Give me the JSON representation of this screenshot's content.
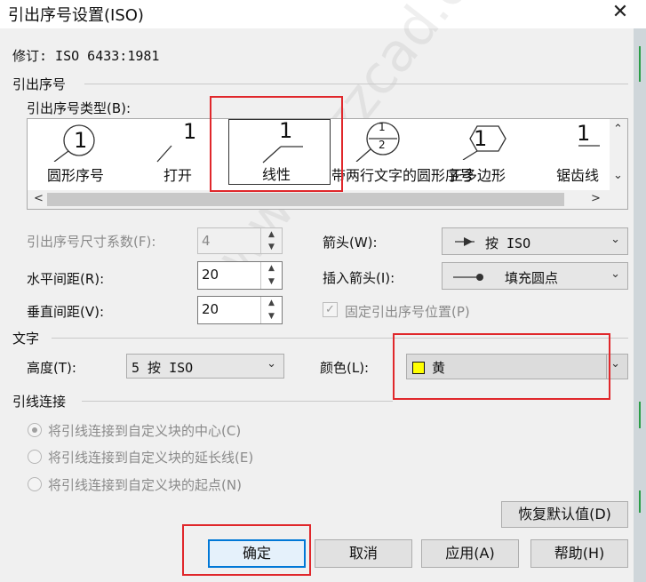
{
  "window": {
    "title": "引出序号设置(ISO)",
    "close_glyph": "✕"
  },
  "revision": "修订: ISO 6433:1981",
  "sections": {
    "balloon": "引出序号",
    "text": "文字",
    "leader": "引线连接"
  },
  "balloon_type": {
    "label": "引出序号类型(B):",
    "items": [
      {
        "label": "圆形序号",
        "number": "1"
      },
      {
        "label": "打开",
        "number": "1"
      },
      {
        "label": "线性",
        "number": "1"
      },
      {
        "label": "带两行文字的圆形序号",
        "number": "1",
        "number2": "2"
      },
      {
        "label": "正多边形",
        "number": "1"
      },
      {
        "label": "锯齿线",
        "number": "1"
      }
    ],
    "selected_index": 2
  },
  "size_factor": {
    "label": "引出序号尺寸系数(F):",
    "value": "4"
  },
  "h_spacing": {
    "label": "水平间距(R):",
    "value": "20"
  },
  "v_spacing": {
    "label": "垂直间距(V):",
    "value": "20"
  },
  "arrow": {
    "label": "箭头(W):",
    "value": "按 ISO"
  },
  "insert_arrow": {
    "label": "插入箭头(I):",
    "value": "填充圆点"
  },
  "fixed_position": {
    "label": "固定引出序号位置(P)",
    "checked": true
  },
  "text_height": {
    "label": "高度(T):",
    "value": "5  按 ISO"
  },
  "text_color": {
    "label": "颜色(L):",
    "value": "黄",
    "swatch": "#ffff00"
  },
  "leader_options": [
    {
      "label": "将引线连接到自定义块的中心(C)",
      "selected": true
    },
    {
      "label": "将引线连接到自定义块的延长线(E)",
      "selected": false
    },
    {
      "label": "将引线连接到自定义块的起点(N)",
      "selected": false
    }
  ],
  "buttons": {
    "restore": "恢复默认值(D)",
    "ok": "确定",
    "cancel": "取消",
    "apply": "应用(A)",
    "help": "帮助(H)"
  },
  "glyphs": {
    "down": "⌄",
    "up": "⌃",
    "left": "<",
    "right": ">",
    "spin_up": "▲",
    "spin_down": "▼",
    "check": "✓"
  },
  "watermark": "www.zzzcad.com",
  "colors": {
    "accent": "#0078d7",
    "highlight": "#e0272b"
  }
}
